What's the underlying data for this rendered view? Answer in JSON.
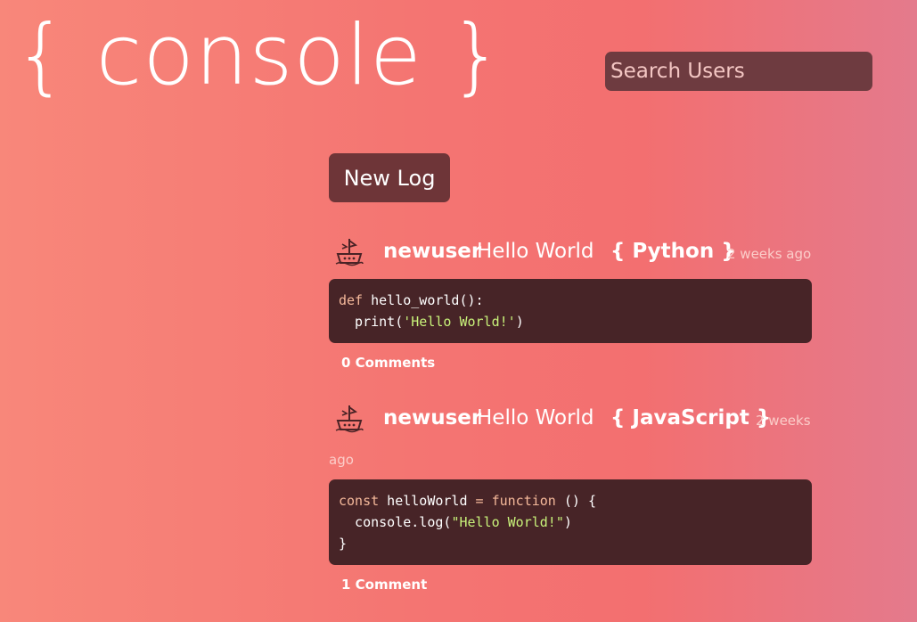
{
  "app": {
    "logo": "{ console }",
    "search_placeholder": "Search Users",
    "new_log_label": "New Log"
  },
  "posts": [
    {
      "username": "newuser",
      "title": "Hello World",
      "language": "{ Python }",
      "time_line1": "2 weeks ago",
      "time_line2": "",
      "code_lines": [
        "def hello_world():",
        "  print('Hello World!')"
      ],
      "comments_label": "0 Comments"
    },
    {
      "username": "newuser",
      "title": "Hello World",
      "language": "{ JavaScript }",
      "time_line1": "2 weeks",
      "time_line2": "ago",
      "code_lines": [
        "const helloWorld = function () {",
        "  console.log(\"Hello World!\")",
        "}"
      ],
      "comments_label": "1 Comment"
    }
  ],
  "colors": {
    "button_bg": "#6e3538",
    "search_bg": "#6e3b40",
    "code_bg": "#472427",
    "string_color": "#c8f27a"
  },
  "icons": {
    "avatar": "ship-avatar-icon"
  }
}
